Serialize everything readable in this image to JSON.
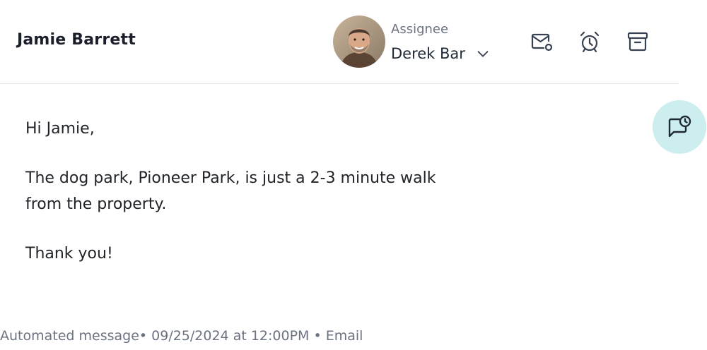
{
  "header": {
    "contact_name": "Jamie Barrett",
    "assignee_label": "Assignee",
    "assignee_name": "Derek Bar",
    "icons": [
      "mail-badge-icon",
      "alarm-clock-icon",
      "archive-icon",
      "chevron-down-icon"
    ]
  },
  "message": {
    "greeting": "Hi Jamie,",
    "body_line1": "The dog park, Pioneer Park, is just a 2-3 minute walk",
    "body_line2": "from the property.",
    "closing": "Thank you!"
  },
  "floating_action": {
    "icon": "scheduled-message-icon",
    "color": "#cdeeee"
  },
  "footer": {
    "meta": "Automated message• 09/25/2024 at 12:00PM • Email"
  }
}
